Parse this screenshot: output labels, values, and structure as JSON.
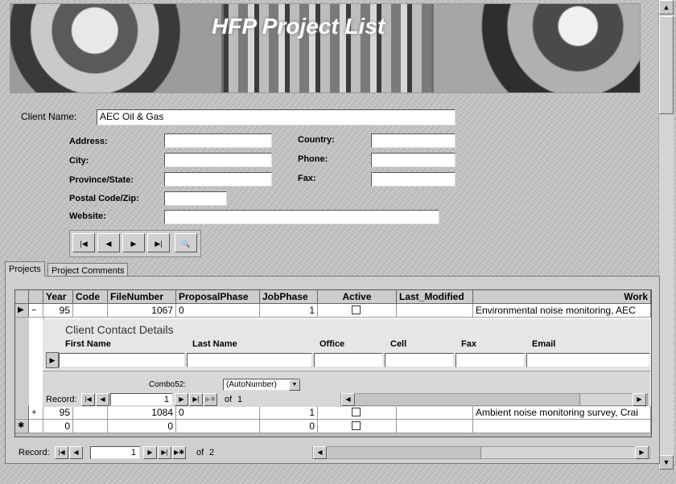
{
  "banner": {
    "title": "HFP Project List"
  },
  "client": {
    "name_label": "Client Name:",
    "name_value": "AEC Oil & Gas",
    "address_label": "Address:",
    "city_label": "City:",
    "province_label": "Province/State:",
    "postal_label": "Postal Code/Zip:",
    "website_label": "Website:",
    "country_label": "Country:",
    "phone_label": "Phone:",
    "fax_label": "Fax:"
  },
  "nav": {
    "first": "|◀",
    "prev": "◀",
    "next": "▶",
    "last": "▶|",
    "find": "🔍"
  },
  "tabs": [
    {
      "label": "Projects"
    },
    {
      "label": "Project Comments"
    }
  ],
  "grid": {
    "headers": [
      "Year",
      "Code",
      "FileNumber",
      "ProposalPhase",
      "JobPhase",
      "Active",
      "Last_Modified",
      "Work"
    ],
    "rows": [
      {
        "year": "95",
        "code": "",
        "file": "1067",
        "proposal": "0",
        "job": "1",
        "modified": "",
        "work": "Environmental noise monitoring, AEC",
        "expander": "−"
      },
      {
        "year": "95",
        "code": "",
        "file": "1084",
        "proposal": "0",
        "job": "1",
        "modified": "",
        "work": "Ambient noise monitoring survey, Crai",
        "expander": "+"
      },
      {
        "year": "0",
        "code": "",
        "file": "0",
        "proposal": "",
        "job": "0",
        "modified": "",
        "work": "",
        "expander": ""
      }
    ],
    "new_row_marker": "✱"
  },
  "subform": {
    "title": "Client Contact Details",
    "headers": [
      "First Name",
      "Last Name",
      "Office",
      "Cell",
      "Fax",
      "Email"
    ],
    "combo_label": "Combo52:",
    "combo_value": "(AutoNumber)",
    "record_label": "Record:",
    "record_value": "1",
    "record_of": "of",
    "record_total": "1"
  },
  "main_recbar": {
    "record_label": "Record:",
    "record_value": "1",
    "record_of": "of",
    "record_total": "2"
  }
}
